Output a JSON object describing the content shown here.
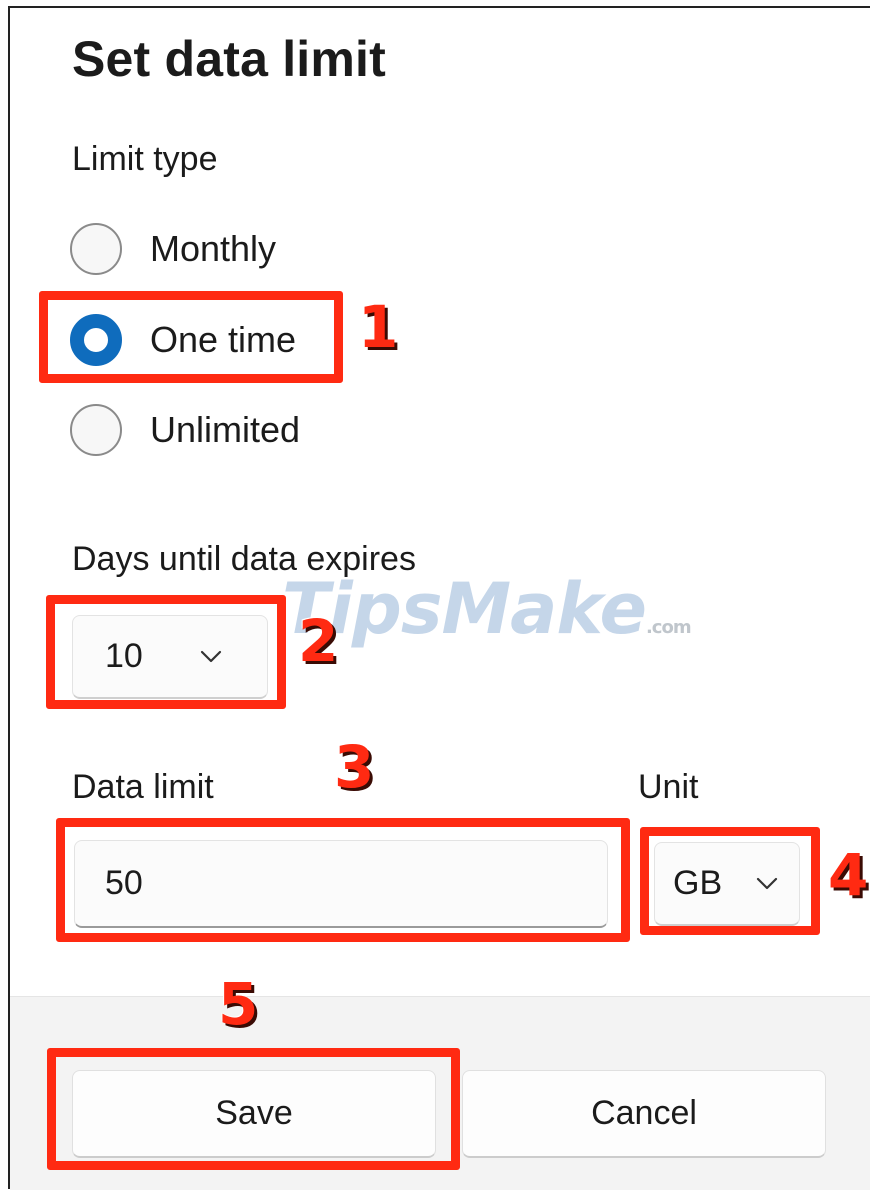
{
  "dialog": {
    "title": "Set data limit",
    "limit_type": {
      "label": "Limit type",
      "options": [
        {
          "label": "Monthly",
          "checked": false
        },
        {
          "label": "One time",
          "checked": true
        },
        {
          "label": "Unlimited",
          "checked": false
        }
      ]
    },
    "days_until_expire": {
      "label": "Days until data expires",
      "value": "10"
    },
    "data_limit": {
      "label": "Data limit",
      "value": "50"
    },
    "unit": {
      "label": "Unit",
      "value": "GB"
    },
    "buttons": {
      "save": "Save",
      "cancel": "Cancel"
    }
  },
  "annotations": {
    "step_1": "1",
    "step_2": "2",
    "step_3": "3",
    "step_4": "4",
    "step_5": "5",
    "color": "#ff2a12"
  },
  "watermark": {
    "brand": "TipsMake",
    "suffix": ".com"
  },
  "colors": {
    "accent": "#0f6cbd",
    "footer_bg": "#f3f3f3"
  }
}
